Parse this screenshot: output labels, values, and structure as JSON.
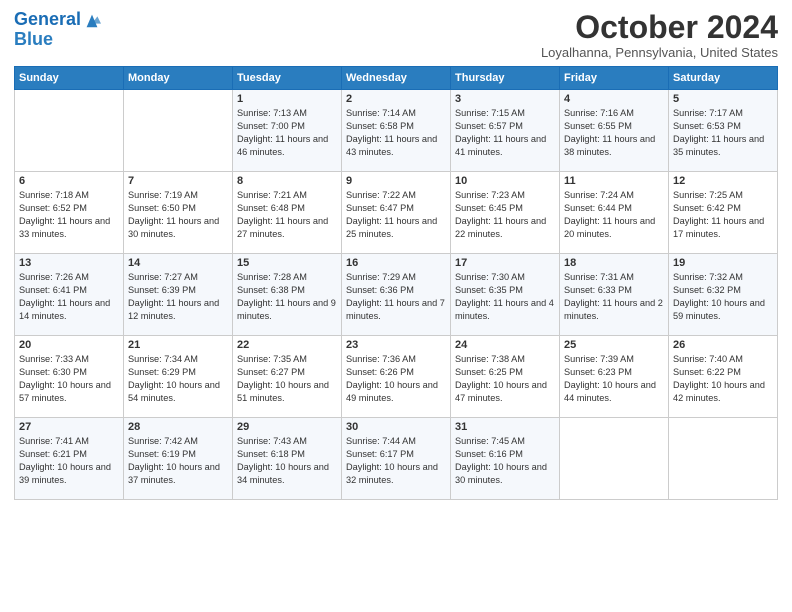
{
  "header": {
    "logo_line1": "General",
    "logo_line2": "Blue",
    "month_title": "October 2024",
    "location": "Loyalhanna, Pennsylvania, United States"
  },
  "days_of_week": [
    "Sunday",
    "Monday",
    "Tuesday",
    "Wednesday",
    "Thursday",
    "Friday",
    "Saturday"
  ],
  "weeks": [
    [
      {
        "day": "",
        "info": ""
      },
      {
        "day": "",
        "info": ""
      },
      {
        "day": "1",
        "info": "Sunrise: 7:13 AM\nSunset: 7:00 PM\nDaylight: 11 hours and 46 minutes."
      },
      {
        "day": "2",
        "info": "Sunrise: 7:14 AM\nSunset: 6:58 PM\nDaylight: 11 hours and 43 minutes."
      },
      {
        "day": "3",
        "info": "Sunrise: 7:15 AM\nSunset: 6:57 PM\nDaylight: 11 hours and 41 minutes."
      },
      {
        "day": "4",
        "info": "Sunrise: 7:16 AM\nSunset: 6:55 PM\nDaylight: 11 hours and 38 minutes."
      },
      {
        "day": "5",
        "info": "Sunrise: 7:17 AM\nSunset: 6:53 PM\nDaylight: 11 hours and 35 minutes."
      }
    ],
    [
      {
        "day": "6",
        "info": "Sunrise: 7:18 AM\nSunset: 6:52 PM\nDaylight: 11 hours and 33 minutes."
      },
      {
        "day": "7",
        "info": "Sunrise: 7:19 AM\nSunset: 6:50 PM\nDaylight: 11 hours and 30 minutes."
      },
      {
        "day": "8",
        "info": "Sunrise: 7:21 AM\nSunset: 6:48 PM\nDaylight: 11 hours and 27 minutes."
      },
      {
        "day": "9",
        "info": "Sunrise: 7:22 AM\nSunset: 6:47 PM\nDaylight: 11 hours and 25 minutes."
      },
      {
        "day": "10",
        "info": "Sunrise: 7:23 AM\nSunset: 6:45 PM\nDaylight: 11 hours and 22 minutes."
      },
      {
        "day": "11",
        "info": "Sunrise: 7:24 AM\nSunset: 6:44 PM\nDaylight: 11 hours and 20 minutes."
      },
      {
        "day": "12",
        "info": "Sunrise: 7:25 AM\nSunset: 6:42 PM\nDaylight: 11 hours and 17 minutes."
      }
    ],
    [
      {
        "day": "13",
        "info": "Sunrise: 7:26 AM\nSunset: 6:41 PM\nDaylight: 11 hours and 14 minutes."
      },
      {
        "day": "14",
        "info": "Sunrise: 7:27 AM\nSunset: 6:39 PM\nDaylight: 11 hours and 12 minutes."
      },
      {
        "day": "15",
        "info": "Sunrise: 7:28 AM\nSunset: 6:38 PM\nDaylight: 11 hours and 9 minutes."
      },
      {
        "day": "16",
        "info": "Sunrise: 7:29 AM\nSunset: 6:36 PM\nDaylight: 11 hours and 7 minutes."
      },
      {
        "day": "17",
        "info": "Sunrise: 7:30 AM\nSunset: 6:35 PM\nDaylight: 11 hours and 4 minutes."
      },
      {
        "day": "18",
        "info": "Sunrise: 7:31 AM\nSunset: 6:33 PM\nDaylight: 11 hours and 2 minutes."
      },
      {
        "day": "19",
        "info": "Sunrise: 7:32 AM\nSunset: 6:32 PM\nDaylight: 10 hours and 59 minutes."
      }
    ],
    [
      {
        "day": "20",
        "info": "Sunrise: 7:33 AM\nSunset: 6:30 PM\nDaylight: 10 hours and 57 minutes."
      },
      {
        "day": "21",
        "info": "Sunrise: 7:34 AM\nSunset: 6:29 PM\nDaylight: 10 hours and 54 minutes."
      },
      {
        "day": "22",
        "info": "Sunrise: 7:35 AM\nSunset: 6:27 PM\nDaylight: 10 hours and 51 minutes."
      },
      {
        "day": "23",
        "info": "Sunrise: 7:36 AM\nSunset: 6:26 PM\nDaylight: 10 hours and 49 minutes."
      },
      {
        "day": "24",
        "info": "Sunrise: 7:38 AM\nSunset: 6:25 PM\nDaylight: 10 hours and 47 minutes."
      },
      {
        "day": "25",
        "info": "Sunrise: 7:39 AM\nSunset: 6:23 PM\nDaylight: 10 hours and 44 minutes."
      },
      {
        "day": "26",
        "info": "Sunrise: 7:40 AM\nSunset: 6:22 PM\nDaylight: 10 hours and 42 minutes."
      }
    ],
    [
      {
        "day": "27",
        "info": "Sunrise: 7:41 AM\nSunset: 6:21 PM\nDaylight: 10 hours and 39 minutes."
      },
      {
        "day": "28",
        "info": "Sunrise: 7:42 AM\nSunset: 6:19 PM\nDaylight: 10 hours and 37 minutes."
      },
      {
        "day": "29",
        "info": "Sunrise: 7:43 AM\nSunset: 6:18 PM\nDaylight: 10 hours and 34 minutes."
      },
      {
        "day": "30",
        "info": "Sunrise: 7:44 AM\nSunset: 6:17 PM\nDaylight: 10 hours and 32 minutes."
      },
      {
        "day": "31",
        "info": "Sunrise: 7:45 AM\nSunset: 6:16 PM\nDaylight: 10 hours and 30 minutes."
      },
      {
        "day": "",
        "info": ""
      },
      {
        "day": "",
        "info": ""
      }
    ]
  ]
}
